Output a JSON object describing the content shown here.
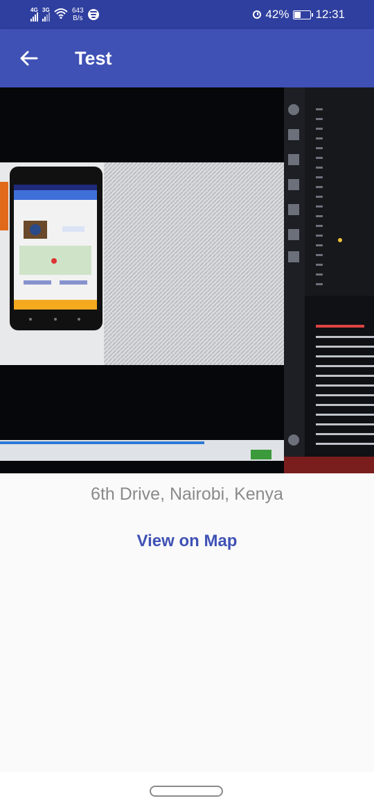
{
  "status_bar": {
    "network_1": "4G",
    "network_2": "3G",
    "speed_value": "643",
    "speed_unit": "B/s",
    "battery": "42%",
    "battery_level": 0.42,
    "time": "12:31",
    "icons": [
      "signal-icon",
      "signal-icon",
      "wifi-icon",
      "spotify-icon",
      "alarm-icon",
      "battery-icon"
    ]
  },
  "app_bar": {
    "title": "Test",
    "back_icon": "arrow-left-icon",
    "background": "#3f51b5"
  },
  "place": {
    "address": "6th Drive, Nairobi, Kenya",
    "view_map_label": "View on Map"
  },
  "colors": {
    "primary": "#3f51b5",
    "status_bar": "#2f3f9f",
    "address_text": "#8a8a8a"
  }
}
